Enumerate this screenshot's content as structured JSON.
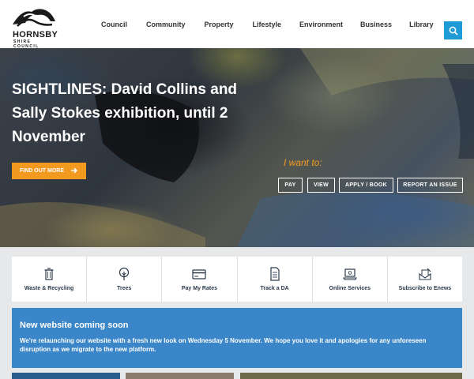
{
  "header": {
    "logo_text": "HORNSBY",
    "logo_sub": "SHIRE COUNCIL",
    "nav": [
      "Council",
      "Community",
      "Property",
      "Lifestyle",
      "Environment",
      "Business",
      "Library"
    ],
    "search_icon": "search-icon",
    "accent_color": "#1e9bd7"
  },
  "hero": {
    "title": "SIGHTLINES: David Collins and Sally Stokes exhibition, until 2 November",
    "cta_label": "FIND OUT MORE",
    "cta_color": "#f29a1f",
    "i_want_label": "I want to:",
    "quick_buttons": [
      "PAY",
      "VIEW",
      "APPLY / BOOK",
      "REPORT AN ISSUE"
    ]
  },
  "quick_links": [
    {
      "label": "Waste & Recycling",
      "icon": "bin-icon"
    },
    {
      "label": "Trees",
      "icon": "tree-icon"
    },
    {
      "label": "Pay My Rates",
      "icon": "credit-card-icon"
    },
    {
      "label": "Track a DA",
      "icon": "document-icon"
    },
    {
      "label": "Online Services",
      "icon": "laptop-icon"
    },
    {
      "label": "Subscribe to Enews",
      "icon": "newsletter-icon"
    }
  ],
  "notice": {
    "title": "New website coming soon",
    "body": "We're relaunching our website with a fresh new look on Wednesday 5 November. We hope you love it and apologies for any unforeseen disruption as we migrate to the new platform.",
    "color": "#3a86c8"
  }
}
